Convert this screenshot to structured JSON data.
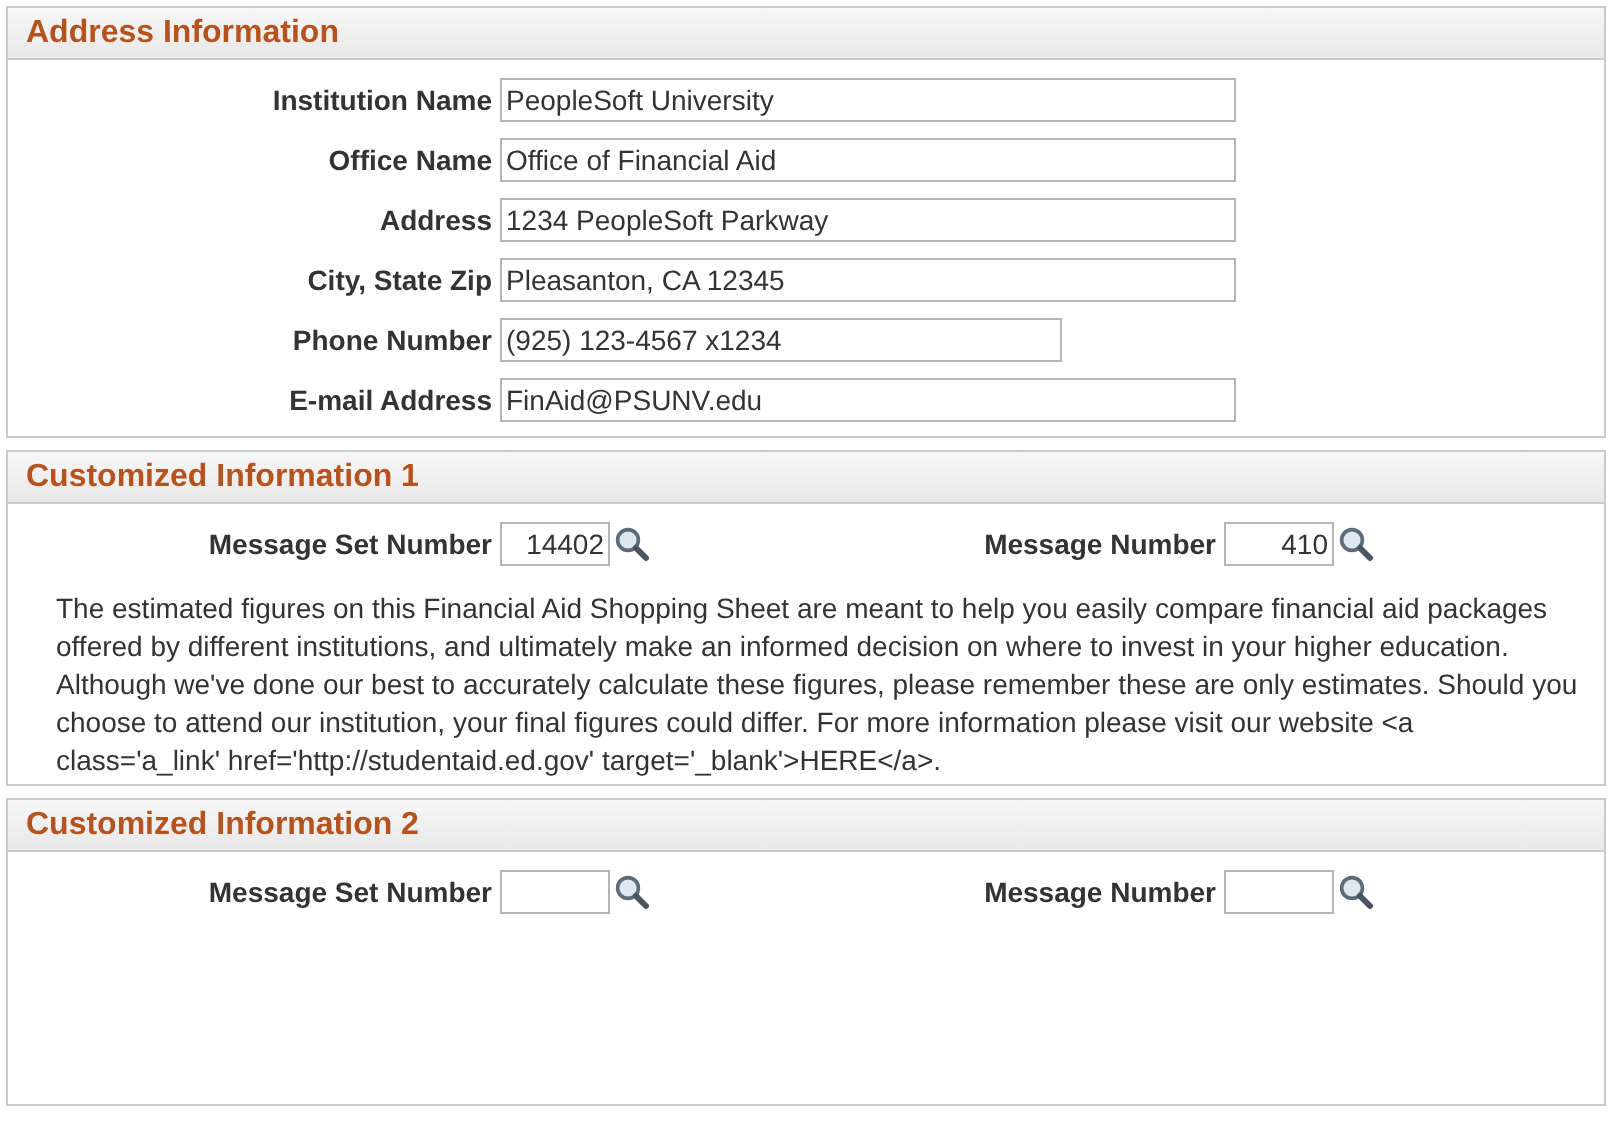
{
  "address_section": {
    "title": "Address Information",
    "fields": [
      {
        "label": "Institution Name",
        "value": "PeopleSoft University",
        "kind": "long"
      },
      {
        "label": "Office Name",
        "value": "Office of Financial Aid",
        "kind": "long"
      },
      {
        "label": "Address",
        "value": "1234 PeopleSoft Parkway",
        "kind": "long"
      },
      {
        "label": "City, State Zip",
        "value": "Pleasanton, CA 12345",
        "kind": "long"
      },
      {
        "label": "Phone Number",
        "value": "(925) 123-4567 x1234",
        "kind": "phone"
      },
      {
        "label": "E-mail Address",
        "value": "FinAid@PSUNV.edu",
        "kind": "long"
      }
    ]
  },
  "custom_sections": [
    {
      "title": "Customized Information 1",
      "message_set": {
        "label": "Message Set Number",
        "value": "14402"
      },
      "message": {
        "label": "Message Number",
        "value": "410"
      },
      "text": "The estimated figures on this Financial Aid Shopping Sheet are meant to help you easily compare financial aid packages offered by different institutions, and ultimately make an informed decision on where to invest in your higher education. Although we've done our best to accurately calculate these figures, please remember these are only estimates. Should you choose to attend our institution, your final figures could differ. For more information please visit our website <a class='a_link' href='http://studentaid.ed.gov' target='_blank'>HERE</a>."
    },
    {
      "title": "Customized Information 2",
      "message_set": {
        "label": "Message Set Number"
      },
      "message": {
        "label": "Message Number"
      }
    }
  ]
}
